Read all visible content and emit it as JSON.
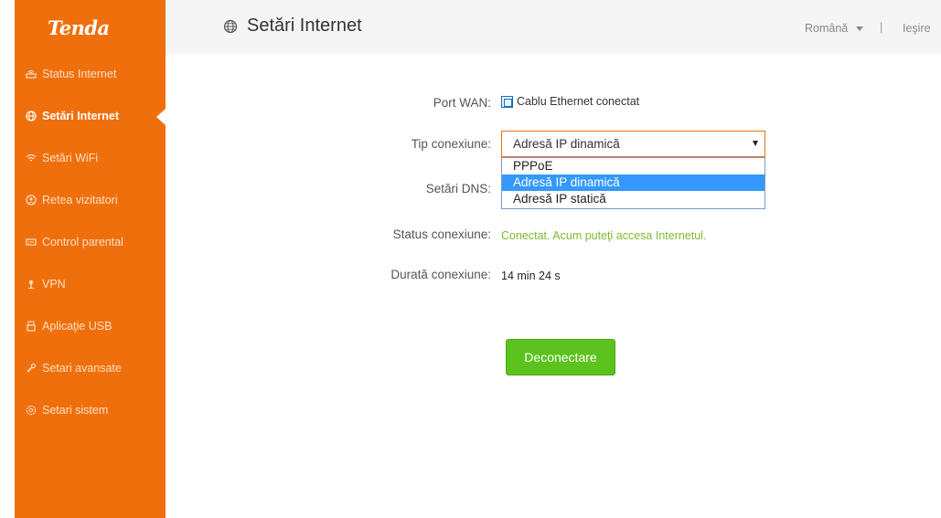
{
  "brand": {
    "logo": "Tenda"
  },
  "sidebar": {
    "items": [
      {
        "label": "Status Internet",
        "icon": "router-icon",
        "active": false
      },
      {
        "label": "Setări Internet",
        "icon": "globe-icon",
        "active": true
      },
      {
        "label": "Setări WiFi",
        "icon": "wifi-icon",
        "active": false
      },
      {
        "label": "Retea vizitatori",
        "icon": "guest-icon",
        "active": false
      },
      {
        "label": "Control parental",
        "icon": "parental-icon",
        "active": false
      },
      {
        "label": "VPN",
        "icon": "vpn-icon",
        "active": false
      },
      {
        "label": "Aplicaţie USB",
        "icon": "usb-icon",
        "active": false
      },
      {
        "label": "Setari avansate",
        "icon": "wrench-icon",
        "active": false
      },
      {
        "label": "Setari sistem",
        "icon": "gear-icon",
        "active": false
      }
    ]
  },
  "header": {
    "title": "Setări Internet",
    "language": "Română",
    "separator": "|",
    "logout": "Ieşire"
  },
  "form": {
    "wan_port": {
      "label": "Port WAN:",
      "value": "Cablu Ethernet conectat"
    },
    "connection_type": {
      "label": "Tip conexiune:",
      "selected": "Adresă IP dinamică",
      "options": [
        "PPPoE",
        "Adresă IP dinamică",
        "Adresă IP statică"
      ]
    },
    "dns": {
      "label": "Setări DNS:"
    },
    "connection_status": {
      "label": "Status conexiune:",
      "value": "Conectat. Acum puteţi accesa Internetul."
    },
    "connection_duration": {
      "label": "Durată conexiune:",
      "value": "14 min 24 s"
    },
    "disconnect_button": "Deconectare"
  },
  "colors": {
    "sidebar": "#f06f0d",
    "status_ok": "#7cbb2e",
    "button": "#5cc31e",
    "selected_option": "#3399ff"
  }
}
